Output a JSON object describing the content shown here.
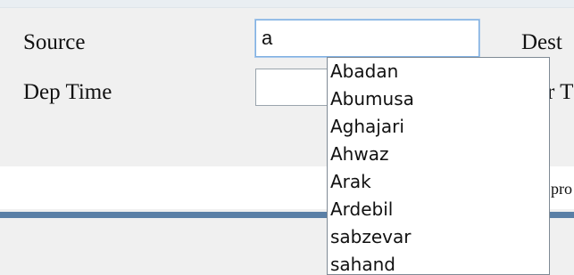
{
  "form": {
    "source_label": "Source",
    "source_value": "a",
    "destination_label": "Dest",
    "dep_time_label": "Dep Time",
    "dep_time_value": "",
    "arr_label_partial": "r T"
  },
  "strip": {
    "partial_text": "pro"
  },
  "autocomplete": {
    "items": [
      "Abadan",
      "Abumusa",
      "Aghajari",
      "Ahwaz",
      "Arak",
      "Ardebil",
      "sabzevar",
      "sahand"
    ]
  },
  "colors": {
    "background": "#f0f0f0",
    "blue_bar": "#5a7fa6",
    "focus_border": "#7fb0e2"
  }
}
